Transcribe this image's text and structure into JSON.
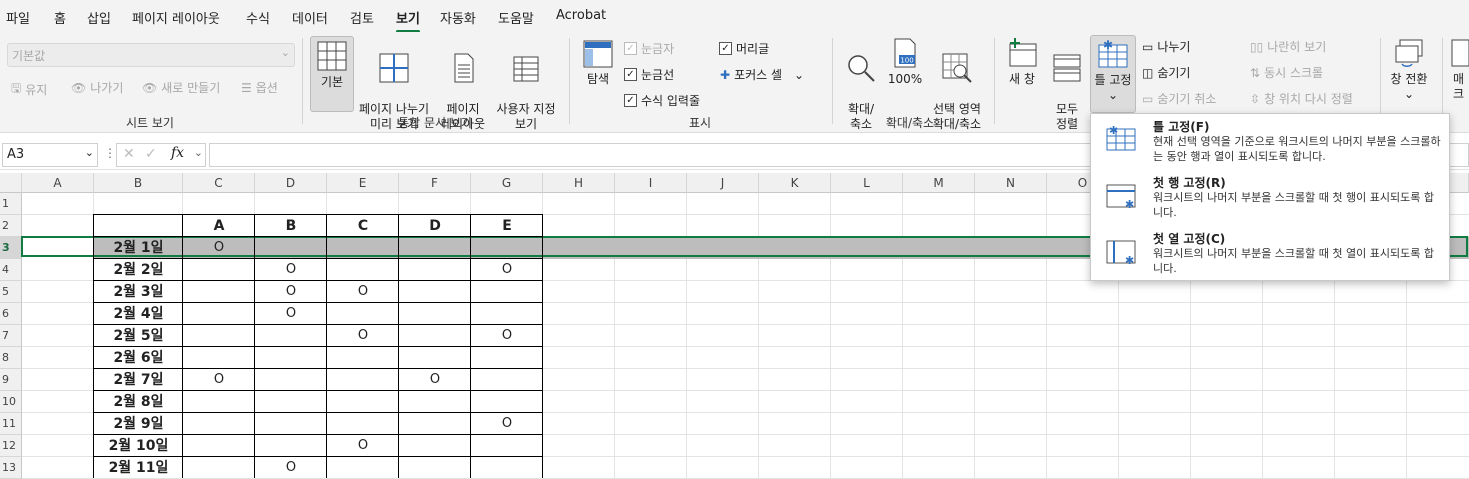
{
  "menu": {
    "tabs": [
      "파일",
      "홈",
      "삽입",
      "페이지 레이아웃",
      "수식",
      "데이터",
      "검토",
      "보기",
      "자동화",
      "도움말",
      "Acrobat"
    ],
    "active": "보기"
  },
  "ribbon": {
    "sheet_view": {
      "dropdown_value": "기본값",
      "keep": "유지",
      "exit": "나가기",
      "new": "새로 만들기",
      "options": "옵션",
      "group_label": "시트 보기"
    },
    "workbook_views": {
      "normal": "기본",
      "page_break": "페이지 나누기\n미리 보기",
      "page_layout": "페이지\n레이아웃",
      "custom": "사용자 지정\n보기",
      "group_label": "통합 문서 보기"
    },
    "show": {
      "navigation": "탐색",
      "ruler": "눈금자",
      "gridlines": "눈금선",
      "formula_bar": "수식 입력줄",
      "headings": "머리글",
      "focus_cell": "포커스 셀",
      "group_label": "표시"
    },
    "zoom": {
      "zoom": "확대/\n축소",
      "hundred": "100%",
      "zoom_to_selection": "선택 영역\n확대/축소",
      "group_label": "확대/축소"
    },
    "window": {
      "new_window": "새 창",
      "arrange_all": "모두\n정렬",
      "freeze_panes": "틀 고정",
      "split": "나누기",
      "hide": "숨기기",
      "unhide": "숨기기 취소",
      "side_by_side": "나란히 보기",
      "sync_scroll": "동시 스크롤",
      "reset_position": "창 위치 다시 정렬",
      "switch_windows": "창 전환",
      "macros_partial": "매크"
    }
  },
  "formula_bar": {
    "name_box": "A3",
    "fx": "fx",
    "value": ""
  },
  "freeze_menu": {
    "items": [
      {
        "title": "틀 고정(F)",
        "desc": "현재 선택 영역을 기준으로 워크시트의 나머지 부분을 스크롤하는 동안 행과 열이 표시되도록 합니다."
      },
      {
        "title": "첫 행 고정(R)",
        "desc": "워크시트의 나머지 부분을 스크롤할 때 첫 행이 표시되도록 합니다."
      },
      {
        "title": "첫 열 고정(C)",
        "desc": "워크시트의 나머지 부분을 스크롤할 때 첫 열이 표시되도록 합니다."
      }
    ]
  },
  "sheet": {
    "columns": [
      "A",
      "B",
      "C",
      "D",
      "E",
      "F",
      "G",
      "H",
      "I",
      "J",
      "K",
      "L",
      "M",
      "N",
      "O"
    ],
    "rows": [
      "1",
      "2",
      "3",
      "4",
      "5",
      "6",
      "7",
      "8",
      "9",
      "10",
      "11",
      "12",
      "13"
    ],
    "selected_row": "3",
    "table_headers": [
      "A",
      "B",
      "C",
      "D",
      "E"
    ],
    "table_rows": [
      {
        "date": "2월 1일",
        "marks": [
          "O",
          "",
          "",
          "",
          ""
        ]
      },
      {
        "date": "2월 2일",
        "marks": [
          "",
          "O",
          "",
          "",
          "O"
        ]
      },
      {
        "date": "2월 3일",
        "marks": [
          "",
          "O",
          "O",
          "",
          ""
        ]
      },
      {
        "date": "2월 4일",
        "marks": [
          "",
          "O",
          "",
          "",
          ""
        ]
      },
      {
        "date": "2월 5일",
        "marks": [
          "",
          "",
          "O",
          "",
          "O"
        ]
      },
      {
        "date": "2월 6일",
        "marks": [
          "",
          "",
          "",
          "",
          ""
        ]
      },
      {
        "date": "2월 7일",
        "marks": [
          "O",
          "",
          "",
          "O",
          ""
        ]
      },
      {
        "date": "2월 8일",
        "marks": [
          "",
          "",
          "",
          "",
          ""
        ]
      },
      {
        "date": "2월 9일",
        "marks": [
          "",
          "",
          "",
          "",
          "O"
        ]
      },
      {
        "date": "2월 10일",
        "marks": [
          "",
          "",
          "O",
          "",
          ""
        ]
      },
      {
        "date": "2월 11일",
        "marks": [
          "",
          "O",
          "",
          "",
          ""
        ]
      }
    ]
  },
  "colors": {
    "accent": "#107c41",
    "selection_fill": "#bdbdbd"
  }
}
